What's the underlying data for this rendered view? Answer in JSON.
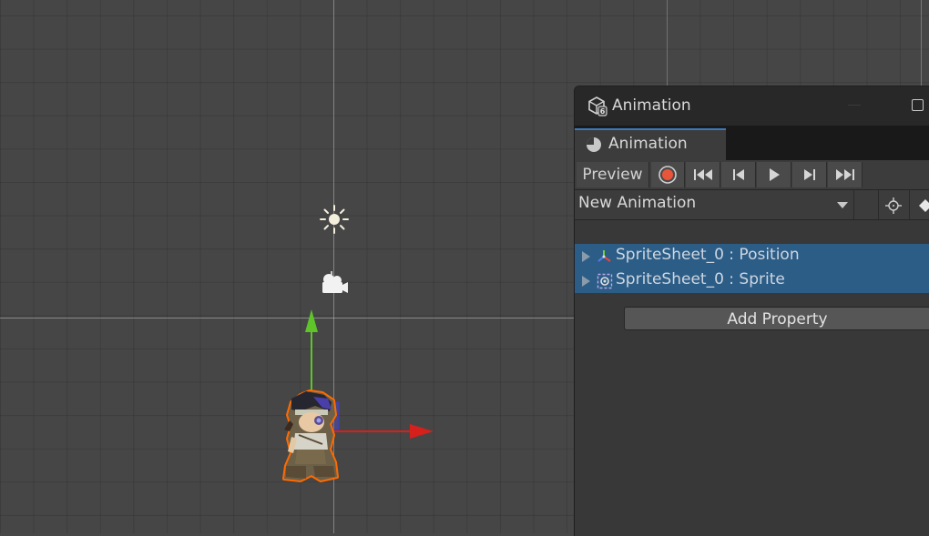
{
  "window": {
    "title": "Animation"
  },
  "tab": {
    "label": "Animation"
  },
  "toolbar": {
    "preview_label": "Preview",
    "buttons": [
      "record-icon",
      "first-keyframe-icon",
      "previous-keyframe-icon",
      "play-icon",
      "next-keyframe-icon",
      "last-keyframe-icon"
    ]
  },
  "clip": {
    "selected": "New Animation"
  },
  "properties": [
    {
      "label": "SpriteSheet_0 : Position",
      "icon": "transform-icon"
    },
    {
      "label": "SpriteSheet_0 : Sprite",
      "icon": "sprite-renderer-icon"
    }
  ],
  "add_property_label": "Add Property",
  "colors": {
    "selection": "#2c5d87",
    "record": "#e8553a",
    "accent_tab": "#3a79bb",
    "gizmo_x": "#d6201c",
    "gizmo_y": "#5ec42a",
    "outline": "#ff6a00"
  }
}
